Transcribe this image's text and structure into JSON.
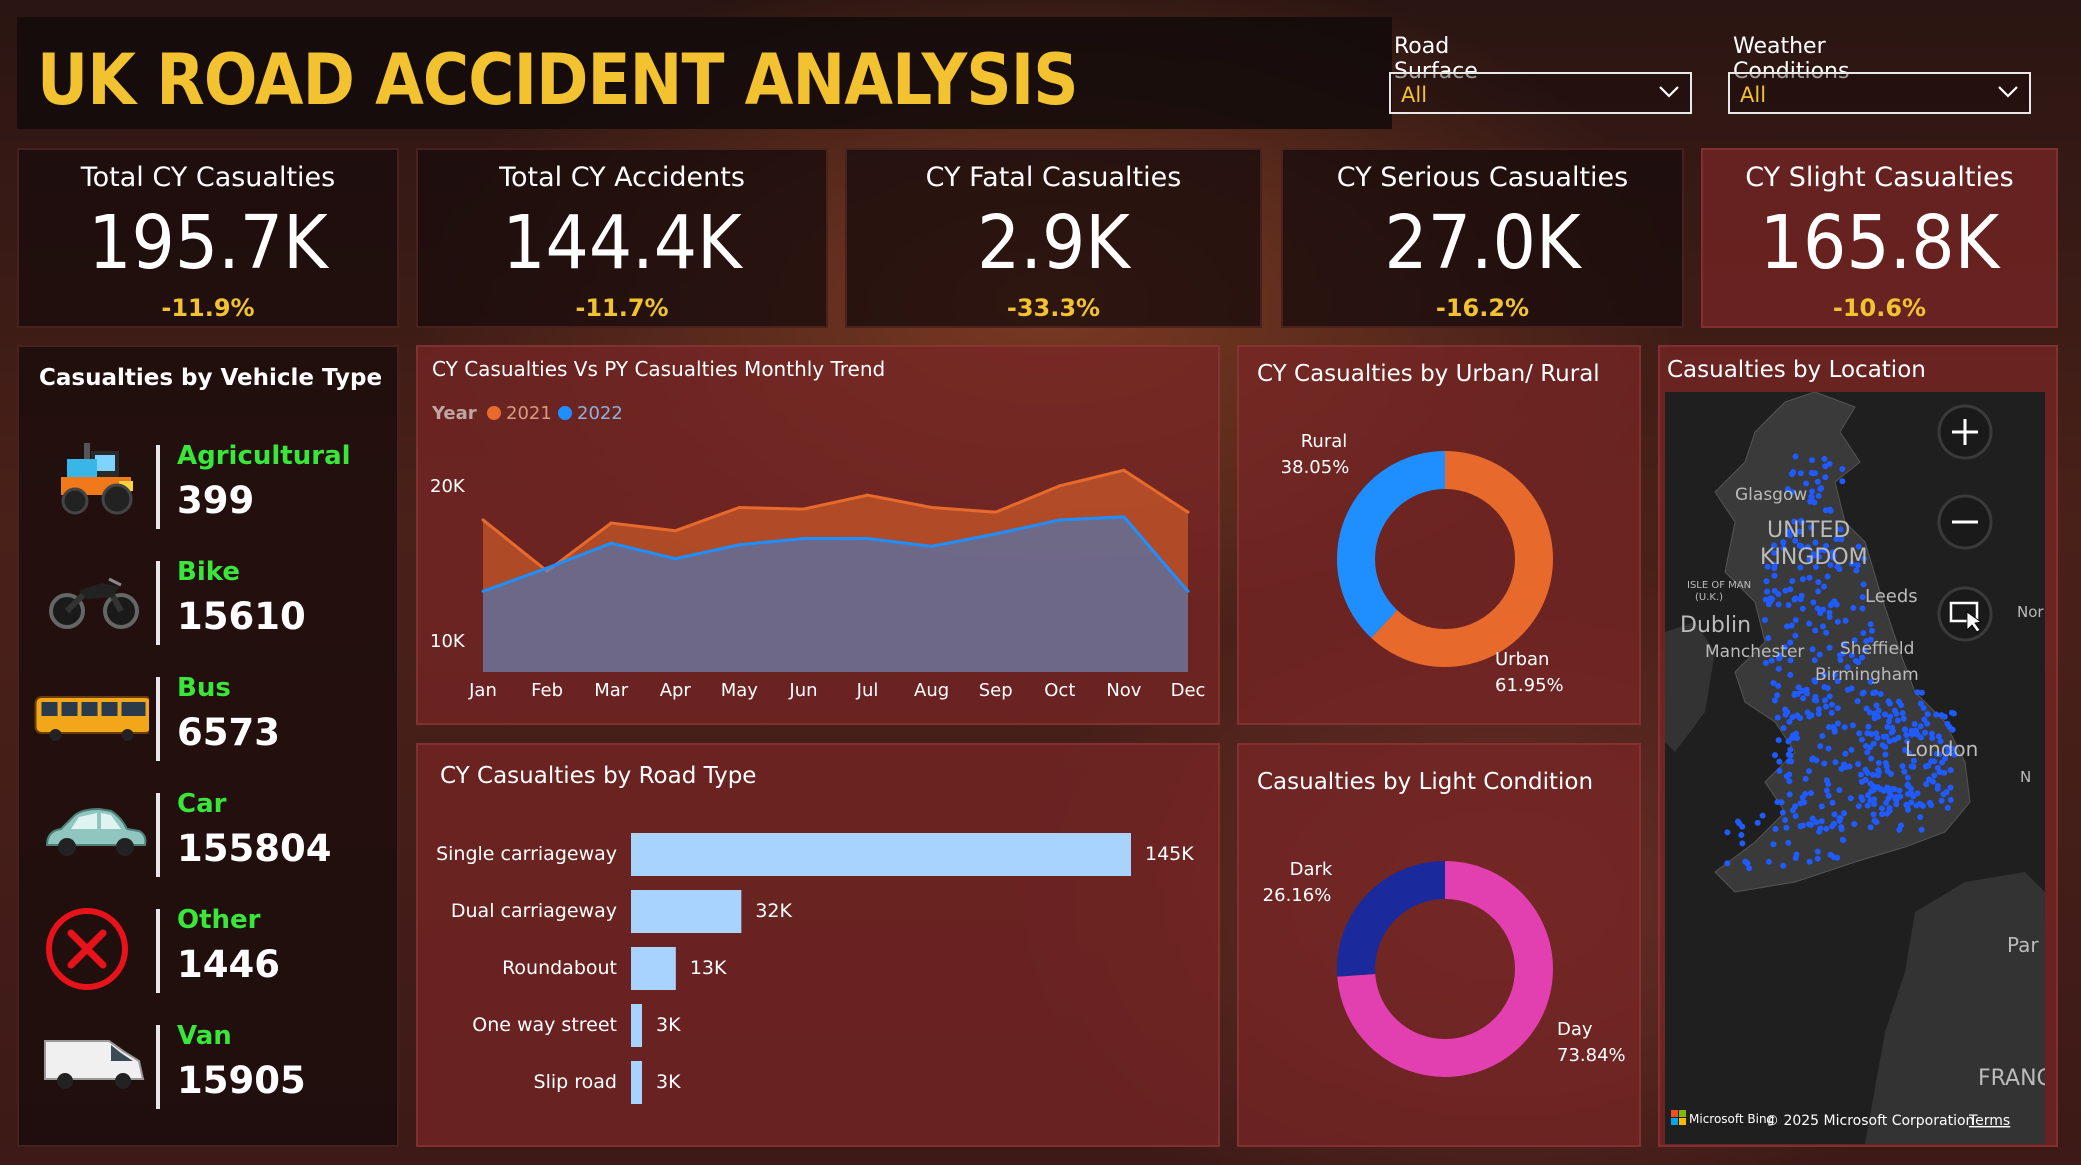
{
  "title": "UK ROAD ACCIDENT ANALYSIS",
  "filters": [
    {
      "label": "Road Surface",
      "value": "All"
    },
    {
      "label": "Weather Conditions",
      "value": "All"
    }
  ],
  "kpis": [
    {
      "label": "Total CY Casualties",
      "value": "195.7K",
      "delta": "-11.9%"
    },
    {
      "label": "Total CY Accidents",
      "value": "144.4K",
      "delta": "-11.7%"
    },
    {
      "label": "CY Fatal Casualties",
      "value": "2.9K",
      "delta": "-33.3%"
    },
    {
      "label": "CY Serious Casualties",
      "value": "27.0K",
      "delta": "-16.2%"
    },
    {
      "label": "CY Slight Casualties",
      "value": "165.8K",
      "delta": "-10.6%"
    }
  ],
  "vehicles": {
    "title": "Casualties by Vehicle Type",
    "items": [
      {
        "name": "Agricultural",
        "count": "399",
        "icon": "tractor-icon"
      },
      {
        "name": "Bike",
        "count": "15610",
        "icon": "motorbike-icon"
      },
      {
        "name": "Bus",
        "count": "6573",
        "icon": "bus-icon"
      },
      {
        "name": "Car",
        "count": "155804",
        "icon": "car-icon"
      },
      {
        "name": "Other",
        "count": "1446",
        "icon": "x-circle-icon"
      },
      {
        "name": "Van",
        "count": "15905",
        "icon": "van-icon"
      }
    ]
  },
  "location": {
    "title": "Casualties by Location",
    "labels": {
      "glasgow": "Glasgow",
      "uk": "UNITED",
      "uk2": "KINGDOM",
      "iom": "ISLE OF MAN",
      "iom2": "(U.K.)",
      "leeds": "Leeds",
      "dublin": "Dublin",
      "manchester": "Manchester",
      "sheffield": "Sheffield",
      "birmingham": "Birmingham",
      "london": "London",
      "par": "Par",
      "franc": "FRANC",
      "nor": "Nor",
      "n": "N"
    },
    "attribution": "Microsoft Bing",
    "copyright": "© 2025 Microsoft Corporation",
    "terms": "Terms"
  },
  "chart_data": [
    {
      "type": "area",
      "title": "CY Casualties Vs PY Casualties Monthly Trend",
      "legend_title": "Year",
      "legend_position": "top-left",
      "categories": [
        "Jan",
        "Feb",
        "Mar",
        "Apr",
        "May",
        "Jun",
        "Jul",
        "Aug",
        "Sep",
        "Oct",
        "Nov",
        "Dec"
      ],
      "yticks": [
        "20K",
        "10K"
      ],
      "ylim": [
        8000,
        22500
      ],
      "series": [
        {
          "name": "2021",
          "color": "#e8692c",
          "values": [
            17800,
            14500,
            17600,
            17100,
            18600,
            18500,
            19400,
            18600,
            18300,
            20000,
            21000,
            18300
          ]
        },
        {
          "name": "2022",
          "color": "#1f8fff",
          "values": [
            13200,
            14700,
            16300,
            15300,
            16200,
            16600,
            16600,
            16100,
            16900,
            17800,
            18000,
            13200
          ]
        }
      ]
    },
    {
      "type": "pie",
      "title": "CY Casualties by Urban/ Rural",
      "slices": [
        {
          "label": "Urban",
          "pct_label": "61.95%",
          "value": 61.95,
          "color": "#e8692c"
        },
        {
          "label": "Rural",
          "pct_label": "38.05%",
          "value": 38.05,
          "color": "#1f8fff"
        }
      ]
    },
    {
      "type": "bar",
      "orientation": "horizontal",
      "title": "CY Casualties by Road Type",
      "categories": [
        "Single carriageway",
        "Dual carriageway",
        "Roundabout",
        "One way street",
        "Slip road"
      ],
      "values": [
        145000,
        32000,
        13000,
        3000,
        3000
      ],
      "data_labels": [
        "145K",
        "32K",
        "13K",
        "3K",
        "3K"
      ],
      "color": "#a9d3ff"
    },
    {
      "type": "pie",
      "title": "Casualties by Light Condition",
      "slices": [
        {
          "label": "Day",
          "pct_label": "73.84%",
          "value": 73.84,
          "color": "#e23fb1"
        },
        {
          "label": "Dark",
          "pct_label": "26.16%",
          "value": 26.16,
          "color": "#1a2a9c"
        }
      ]
    }
  ]
}
